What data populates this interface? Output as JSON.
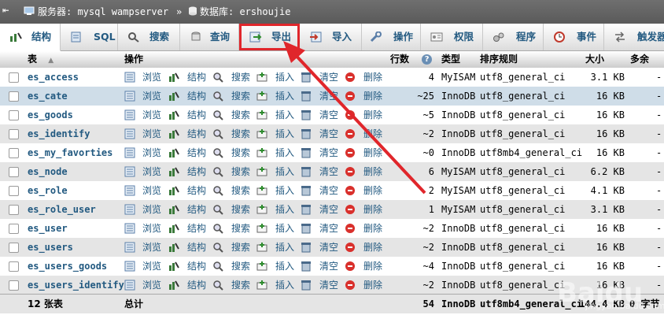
{
  "breadcrumb": {
    "server_label": "服务器: mysql wampserver",
    "sep": "»",
    "db_label": "数据库: ershoujie"
  },
  "tabs": [
    {
      "label": "结构",
      "icon": "structure-icon"
    },
    {
      "label": "SQL",
      "icon": "sql-icon"
    },
    {
      "label": "搜索",
      "icon": "search-icon"
    },
    {
      "label": "查询",
      "icon": "query-icon"
    },
    {
      "label": "导出",
      "icon": "export-icon"
    },
    {
      "label": "导入",
      "icon": "import-icon"
    },
    {
      "label": "操作",
      "icon": "wrench-icon"
    },
    {
      "label": "权限",
      "icon": "privileges-icon"
    },
    {
      "label": "程序",
      "icon": "routines-icon"
    },
    {
      "label": "事件",
      "icon": "events-icon"
    },
    {
      "label": "触发器",
      "icon": "triggers-icon"
    }
  ],
  "columns": {
    "table": "表",
    "sort_indicator": "▲",
    "action": "操作",
    "rows": "行数",
    "rows_help": "?",
    "type": "类型",
    "collation": "排序规则",
    "size": "大小",
    "overhead": "多余"
  },
  "actions": {
    "browse": "浏览",
    "structure": "结构",
    "search": "搜索",
    "insert": "插入",
    "empty": "清空",
    "drop": "删除"
  },
  "tables": [
    {
      "name": "es_access",
      "rows": "4",
      "type": "MyISAM",
      "collation": "utf8_general_ci",
      "size": "3.1 KB",
      "overhead": "-"
    },
    {
      "name": "es_cate",
      "rows": "~25",
      "type": "InnoDB",
      "collation": "utf8_general_ci",
      "size": "16 KB",
      "overhead": "-"
    },
    {
      "name": "es_goods",
      "rows": "~5",
      "type": "InnoDB",
      "collation": "utf8_general_ci",
      "size": "16 KB",
      "overhead": "-"
    },
    {
      "name": "es_identify",
      "rows": "~2",
      "type": "InnoDB",
      "collation": "utf8_general_ci",
      "size": "16 KB",
      "overhead": "-"
    },
    {
      "name": "es_my_favorties",
      "rows": "~0",
      "type": "InnoDB",
      "collation": "utf8mb4_general_ci",
      "size": "16 KB",
      "overhead": "-"
    },
    {
      "name": "es_node",
      "rows": "6",
      "type": "MyISAM",
      "collation": "utf8_general_ci",
      "size": "6.2 KB",
      "overhead": "-"
    },
    {
      "name": "es_role",
      "rows": "2",
      "type": "MyISAM",
      "collation": "utf8_general_ci",
      "size": "4.1 KB",
      "overhead": "-"
    },
    {
      "name": "es_role_user",
      "rows": "1",
      "type": "MyISAM",
      "collation": "utf8_general_ci",
      "size": "3.1 KB",
      "overhead": "-"
    },
    {
      "name": "es_user",
      "rows": "~2",
      "type": "InnoDB",
      "collation": "utf8_general_ci",
      "size": "16 KB",
      "overhead": "-"
    },
    {
      "name": "es_users",
      "rows": "~2",
      "type": "InnoDB",
      "collation": "utf8_general_ci",
      "size": "16 KB",
      "overhead": "-"
    },
    {
      "name": "es_users_goods",
      "rows": "~4",
      "type": "InnoDB",
      "collation": "utf8_general_ci",
      "size": "16 KB",
      "overhead": "-"
    },
    {
      "name": "es_users_identify",
      "rows": "~2",
      "type": "InnoDB",
      "collation": "utf8_general_ci",
      "size": "16 KB",
      "overhead": "-"
    }
  ],
  "footer": {
    "count": "12 张表",
    "total_label": "总计",
    "rows": "54",
    "type": "InnoDB",
    "collation": "utf8mb4_general_ci",
    "size": "144.4 KB",
    "overhead": "0 字节"
  },
  "watermark": {
    "brand": "Baidu",
    "sub": "jingyan.baidu.com"
  },
  "colors": {
    "link": "#235a81",
    "highlight_box": "#e0262b",
    "arrow": "#e0262b",
    "row_alt": "#e5e5e5",
    "row_selected": "#cfdde8"
  }
}
